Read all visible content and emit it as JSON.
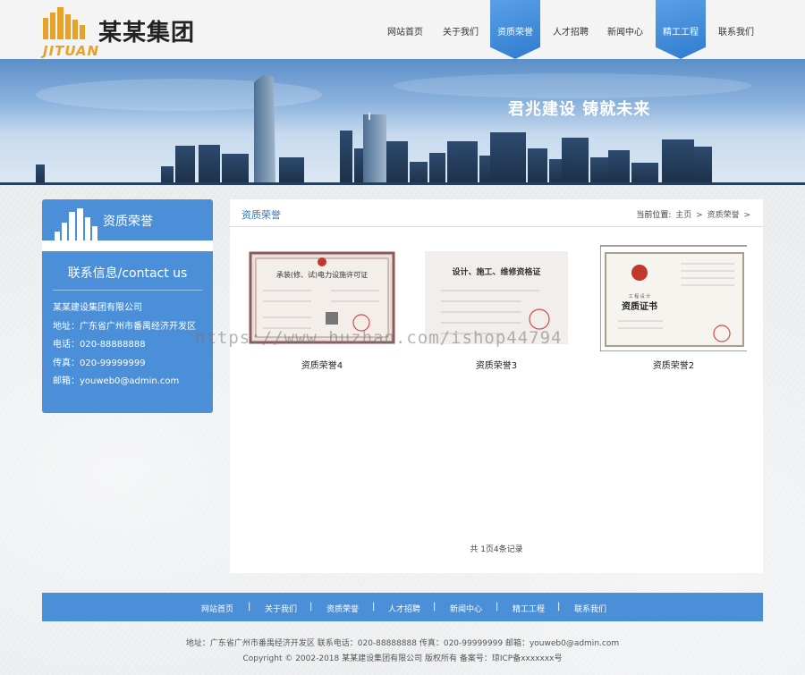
{
  "brand": {
    "name": "某某集团",
    "en": "JITUAN"
  },
  "nav": [
    {
      "label": "网站首页",
      "active": false
    },
    {
      "label": "关于我们",
      "active": false
    },
    {
      "label": "资质荣誉",
      "active": true
    },
    {
      "label": "人才招聘",
      "active": false
    },
    {
      "label": "新闻中心",
      "active": false
    },
    {
      "label": "精工工程",
      "active": true
    },
    {
      "label": "联系我们",
      "active": false
    }
  ],
  "banner": {
    "slogan": "君兆建设 铸就未来"
  },
  "sidebar": {
    "title": "资质荣誉",
    "contact_title": "联系信息/contact us",
    "lines": [
      "某某建设集团有限公司",
      "地址：广东省广州市番禺经济开发区",
      "电话：020-88888888",
      "传真：020-99999999",
      "邮箱：youweb0@admin.com"
    ]
  },
  "main": {
    "title": "资质荣誉",
    "breadcrumb": {
      "label": "当前位置:",
      "home": "主页",
      "sep": ">",
      "current": "资质荣誉",
      "tail": ">"
    },
    "certs": [
      {
        "caption": "资质荣誉4",
        "heading": "承装(修、试)电力设施许可证"
      },
      {
        "caption": "资质荣誉3",
        "heading": "设计、施工、维修资格证"
      },
      {
        "caption": "资质荣誉2",
        "heading": "资质证书",
        "sub": "工 程 设 计"
      }
    ],
    "pagination": "共 1页4条记录"
  },
  "watermark": "https://www.huzhan.com/ishop44794",
  "footer": {
    "nav": [
      "网站首页",
      "关于我们",
      "资质荣誉",
      "人才招聘",
      "新闻中心",
      "精工工程",
      "联系我们"
    ],
    "sep": "|",
    "info": "地址：广东省广州市番禺经济开发区 联系电话：020-88888888 传真：020-99999999 邮箱：youweb0@admin.com",
    "copyright": "Copyright © 2002-2018 某某建设集团有限公司 版权所有    备案号：琼ICP备xxxxxxx号"
  },
  "colors": {
    "accent": "#4a8fd8",
    "title_blue": "#2f74c0",
    "logo_gold": "#e6a22b"
  }
}
